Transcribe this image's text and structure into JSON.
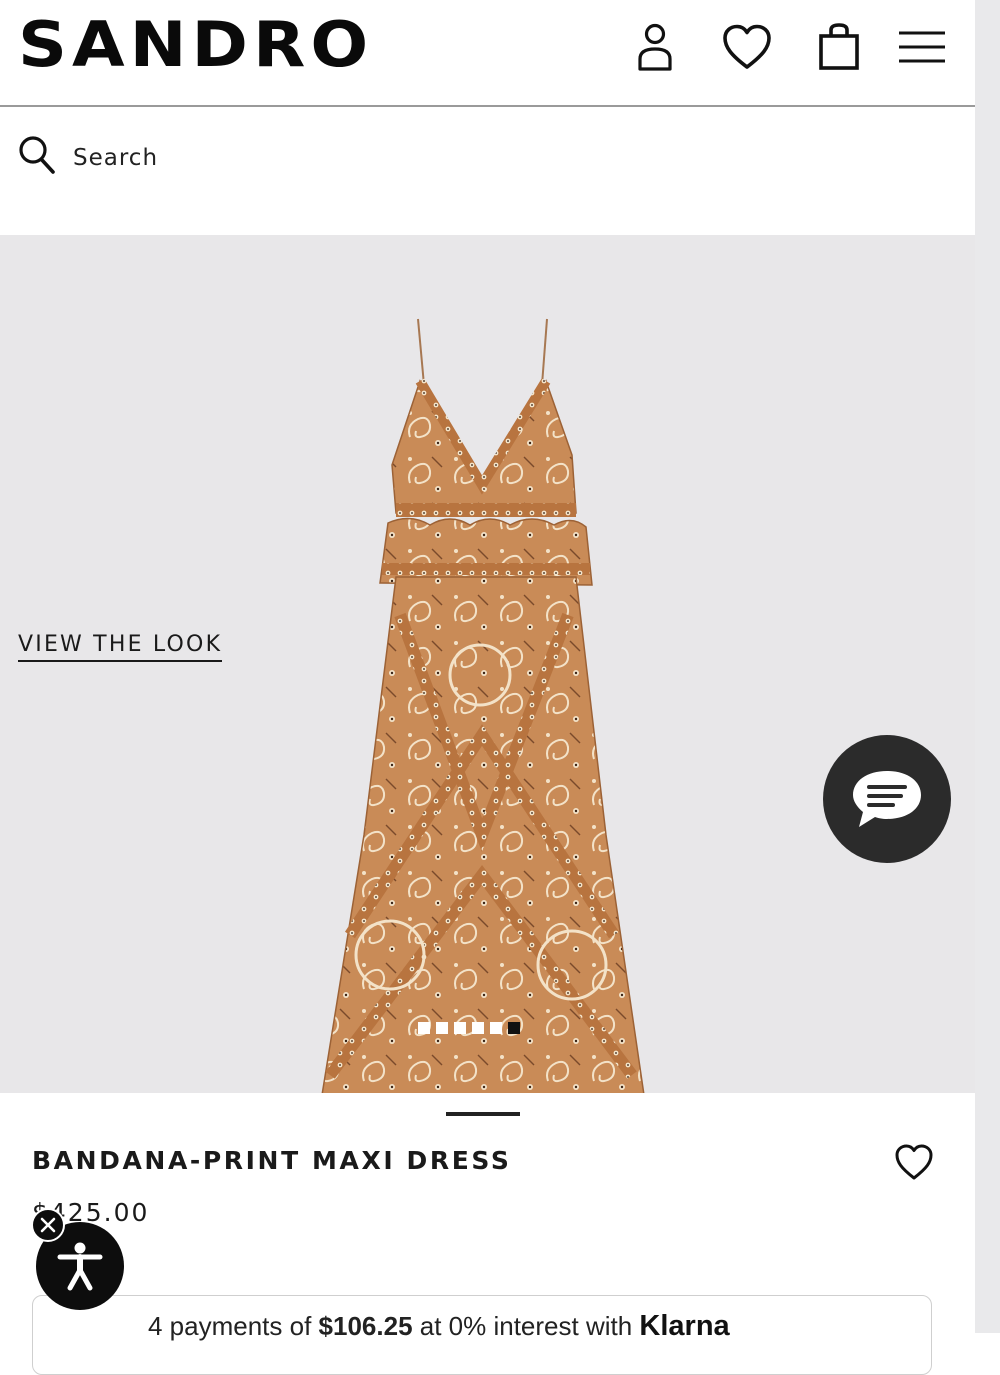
{
  "header": {
    "logo": "SANDRO",
    "icons": [
      "account-icon",
      "wishlist-icon",
      "shopping-bag-icon",
      "menu-icon"
    ]
  },
  "search": {
    "placeholder": "Search"
  },
  "product_image": {
    "view_the_look": "VIEW THE LOOK",
    "carousel": {
      "total": 6,
      "active_index": 5
    },
    "background_color": "#e8e7e9"
  },
  "product": {
    "title": "BANDANA-PRINT MAXI DRESS",
    "price": "$425.00"
  },
  "klarna": {
    "prefix": "4 payments of ",
    "amount": "$106.25",
    "middle": " at 0% interest with ",
    "brand": "Klarna"
  },
  "colors": {
    "text": "#111111",
    "chat_button": "#2b2b2b",
    "dress": "#c88a57"
  }
}
